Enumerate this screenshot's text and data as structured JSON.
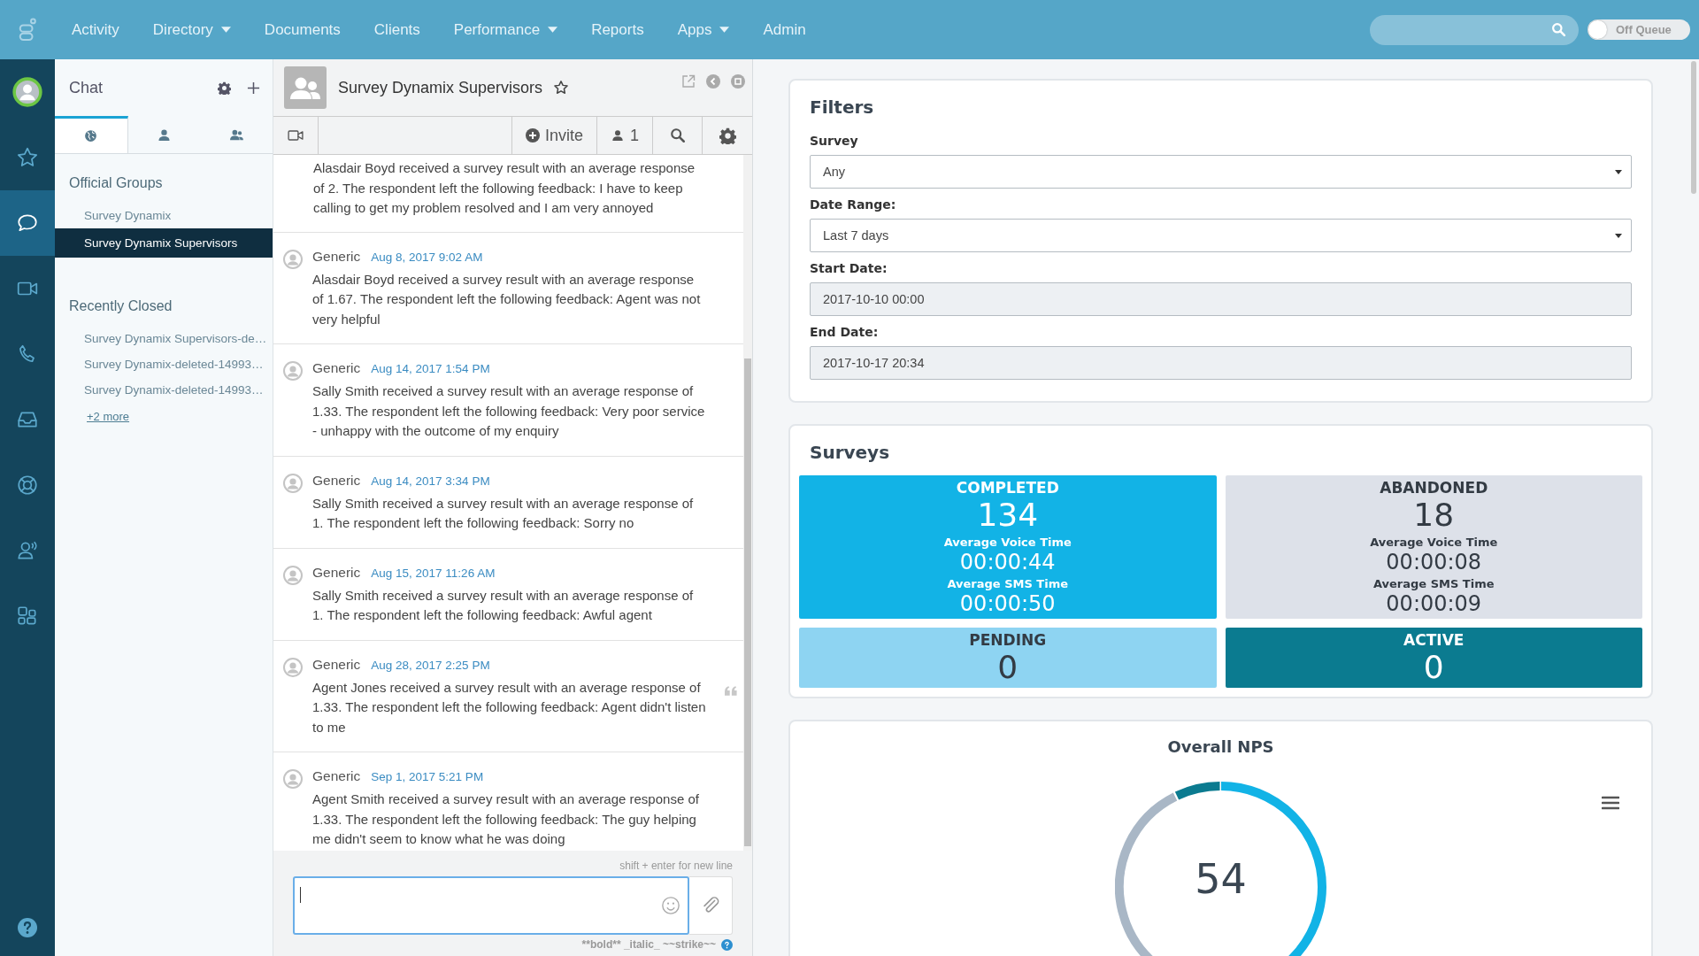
{
  "topbar": {
    "nav": [
      {
        "label": "Activity",
        "dropdown": false
      },
      {
        "label": "Directory",
        "dropdown": true
      },
      {
        "label": "Documents",
        "dropdown": false
      },
      {
        "label": "Clients",
        "dropdown": false
      },
      {
        "label": "Performance",
        "dropdown": true
      },
      {
        "label": "Reports",
        "dropdown": false
      },
      {
        "label": "Apps",
        "dropdown": true
      },
      {
        "label": "Admin",
        "dropdown": false
      }
    ],
    "queue": {
      "label": "Off Queue",
      "on": false
    }
  },
  "rail": {
    "items": [
      {
        "kind": "avatar",
        "selected": false
      },
      {
        "kind": "star",
        "selected": false
      },
      {
        "kind": "chat",
        "selected": true
      },
      {
        "kind": "video",
        "selected": false
      },
      {
        "kind": "phone",
        "selected": false
      },
      {
        "kind": "inbox",
        "selected": false
      },
      {
        "kind": "lifebuoy",
        "selected": false
      },
      {
        "kind": "speaker",
        "selected": false
      },
      {
        "kind": "apps",
        "selected": false
      }
    ],
    "bottom": {
      "kind": "help"
    }
  },
  "chat_sidebar": {
    "title": "Chat",
    "tabs": [
      {
        "kind": "globe",
        "selected": true
      },
      {
        "kind": "person",
        "selected": false
      },
      {
        "kind": "people",
        "selected": false
      }
    ],
    "sections": [
      {
        "title": "Official Groups",
        "items": [
          {
            "label": "Survey Dynamix",
            "selected": false
          },
          {
            "label": "Survey Dynamix Supervisors",
            "selected": true
          }
        ]
      },
      {
        "title": "Recently Closed",
        "items": [
          {
            "label": "Survey Dynamix Supervisors-de…",
            "selected": false
          },
          {
            "label": "Survey Dynamix-deleted-14993…",
            "selected": false
          },
          {
            "label": "Survey Dynamix-deleted-14993…",
            "selected": false
          }
        ],
        "more": "+2 more"
      }
    ]
  },
  "conversation": {
    "title": "Survey Dynamix Supervisors",
    "starred": false,
    "toolbar": {
      "invite": "Invite",
      "participants": "1"
    },
    "messages": [
      {
        "text": "Alasdair Boyd received a survey result with an average response of 2. The respondent left the following feedback: I have to keep calling to get my problem resolved and I am very annoyed",
        "hovered": false
      },
      {
        "author": "Generic",
        "time": "Aug 8, 2017 9:02 AM",
        "text": "Alasdair Boyd received a survey result with an average response of 1.67. The respondent left the following feedback: Agent was not very helpful",
        "hovered": false
      },
      {
        "author": "Generic",
        "time": "Aug 14, 2017 1:54 PM",
        "text": "Sally Smith received a survey result with an average response of 1.33. The respondent left the following feedback: Very poor service - unhappy with the outcome of my enquiry",
        "hovered": false
      },
      {
        "author": "Generic",
        "time": "Aug 14, 2017 3:34 PM",
        "text": "Sally Smith received a survey result with an average response of 1. The respondent left the following feedback: Sorry no",
        "hovered": false
      },
      {
        "author": "Generic",
        "time": "Aug 15, 2017 11:26 AM",
        "text": "Sally Smith received a survey result with an average response of 1. The respondent left the following feedback: Awful agent",
        "hovered": false
      },
      {
        "author": "Generic",
        "time": "Aug 28, 2017 2:25 PM",
        "text": "Agent Jones received a survey result with an average response of 1.33. The respondent left the following feedback: Agent didn't listen to me",
        "hovered": true
      },
      {
        "author": "Generic",
        "time": "Sep 1, 2017 5:21 PM",
        "text": "Agent Smith received a survey result with an average response of 1.33. The respondent left the following feedback: The guy helping me didn't seem to know what he was doing",
        "hovered": false
      }
    ],
    "hint": "shift + enter for new line",
    "format_help": "**bold** _italic_ ~~strike~~"
  },
  "filters": {
    "title": "Filters",
    "fields": [
      {
        "label": "Survey",
        "kind": "select",
        "value": "Any"
      },
      {
        "label": "Date Range:",
        "kind": "select",
        "value": "Last 7 days"
      },
      {
        "label": "Start Date:",
        "kind": "text",
        "value": "2017-10-10 00:00"
      },
      {
        "label": "End Date:",
        "kind": "text",
        "value": "2017-10-17 20:34"
      }
    ]
  },
  "surveys": {
    "title": "Surveys",
    "tiles": [
      {
        "label": "COMPLETED",
        "count": "134",
        "color": "#12b3e6",
        "stats": [
          {
            "label": "Average Voice Time",
            "value": "00:00:44"
          },
          {
            "label": "Average SMS Time",
            "value": "00:00:50"
          }
        ]
      },
      {
        "label": "ABANDONED",
        "count": "18",
        "color": "#dde1e9",
        "stats": [
          {
            "label": "Average Voice Time",
            "value": "00:00:08"
          },
          {
            "label": "Average SMS Time",
            "value": "00:00:09"
          }
        ]
      },
      {
        "label": "PENDING",
        "count": "0",
        "color": "#8ed4f2"
      },
      {
        "label": "ACTIVE",
        "count": "0",
        "color": "#0b7b90"
      }
    ]
  },
  "nps": {
    "title": "Overall NPS",
    "score": "54"
  }
}
